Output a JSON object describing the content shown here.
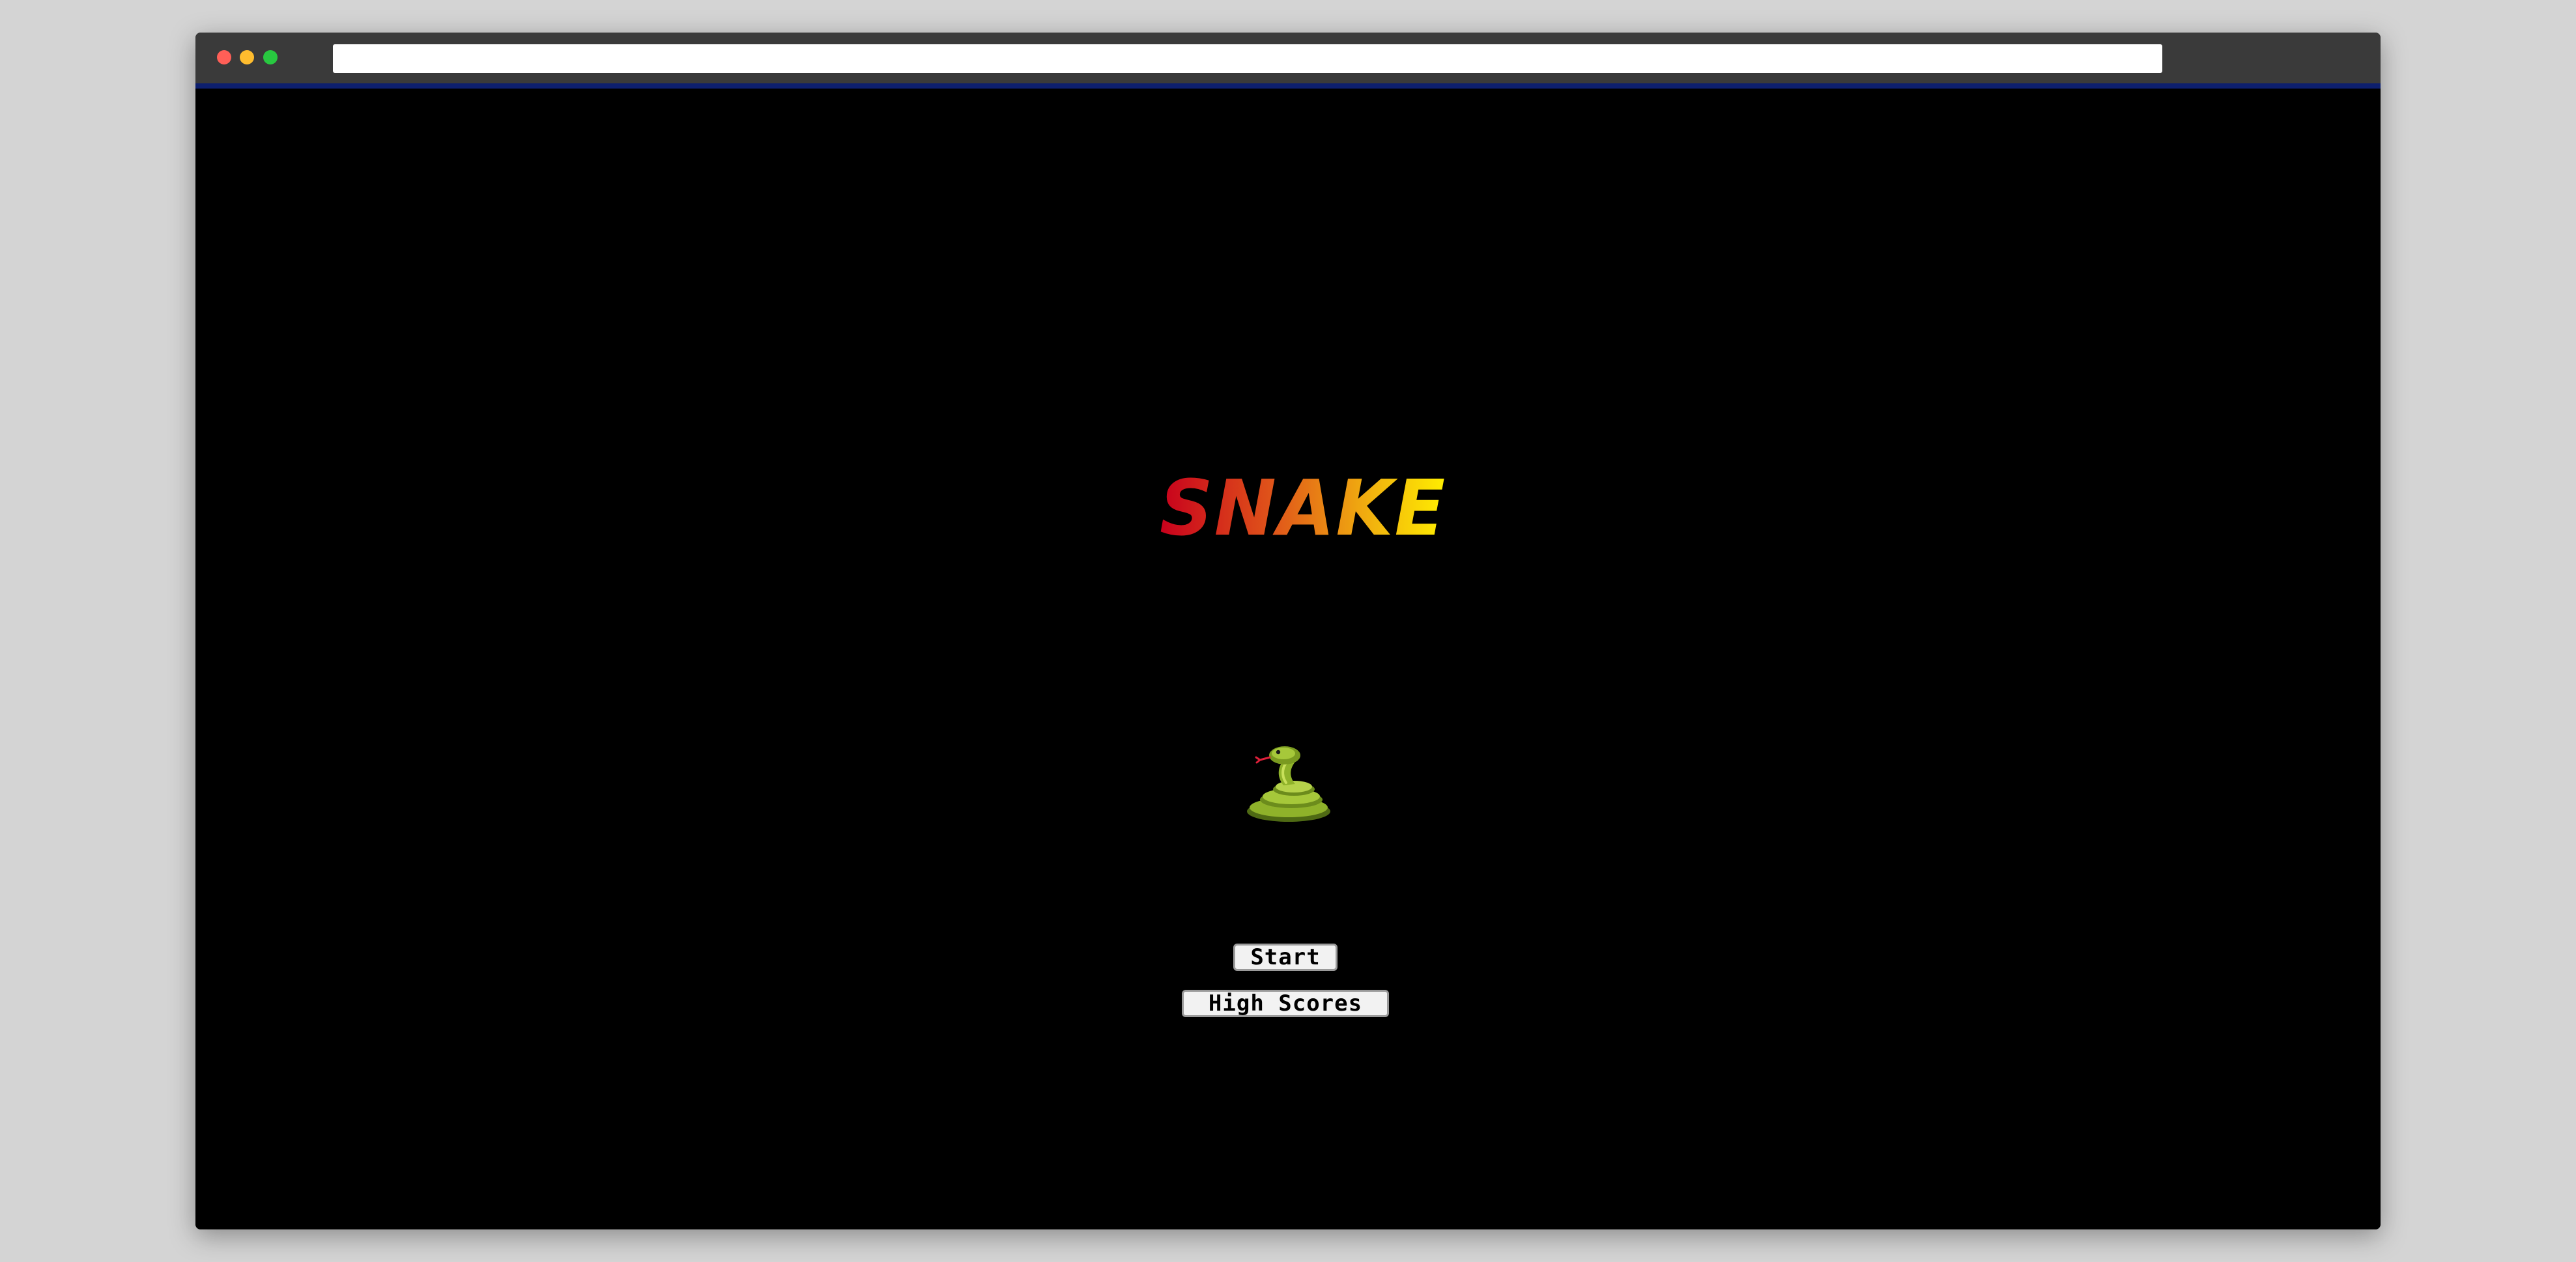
{
  "browser": {
    "address_bar_value": "",
    "traffic_lights": {
      "close_color": "#ff5f57",
      "minimize_color": "#febc2e",
      "maximize_color": "#28c840"
    }
  },
  "game": {
    "title": "SNAKE",
    "title_gradient": [
      "#c8001c",
      "#e0561a",
      "#f2b50e",
      "#ffee00"
    ],
    "mascot_icon": "snake-emoji",
    "menu": {
      "start_label": "Start",
      "high_scores_label": "High Scores"
    }
  }
}
